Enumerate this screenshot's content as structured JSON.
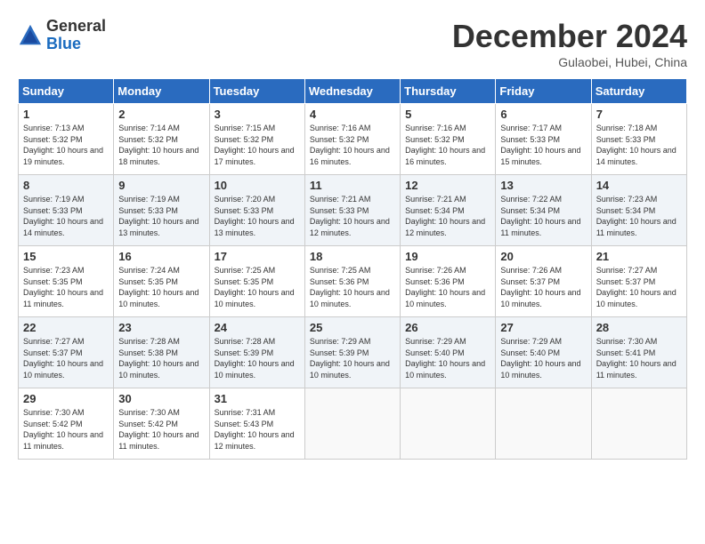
{
  "logo": {
    "general": "General",
    "blue": "Blue"
  },
  "title": "December 2024",
  "location": "Gulaobei, Hubei, China",
  "headers": [
    "Sunday",
    "Monday",
    "Tuesday",
    "Wednesday",
    "Thursday",
    "Friday",
    "Saturday"
  ],
  "weeks": [
    [
      {
        "day": "1",
        "sunrise": "7:13 AM",
        "sunset": "5:32 PM",
        "daylight": "10 hours and 19 minutes."
      },
      {
        "day": "2",
        "sunrise": "7:14 AM",
        "sunset": "5:32 PM",
        "daylight": "10 hours and 18 minutes."
      },
      {
        "day": "3",
        "sunrise": "7:15 AM",
        "sunset": "5:32 PM",
        "daylight": "10 hours and 17 minutes."
      },
      {
        "day": "4",
        "sunrise": "7:16 AM",
        "sunset": "5:32 PM",
        "daylight": "10 hours and 16 minutes."
      },
      {
        "day": "5",
        "sunrise": "7:16 AM",
        "sunset": "5:32 PM",
        "daylight": "10 hours and 16 minutes."
      },
      {
        "day": "6",
        "sunrise": "7:17 AM",
        "sunset": "5:33 PM",
        "daylight": "10 hours and 15 minutes."
      },
      {
        "day": "7",
        "sunrise": "7:18 AM",
        "sunset": "5:33 PM",
        "daylight": "10 hours and 14 minutes."
      }
    ],
    [
      {
        "day": "8",
        "sunrise": "7:19 AM",
        "sunset": "5:33 PM",
        "daylight": "10 hours and 14 minutes."
      },
      {
        "day": "9",
        "sunrise": "7:19 AM",
        "sunset": "5:33 PM",
        "daylight": "10 hours and 13 minutes."
      },
      {
        "day": "10",
        "sunrise": "7:20 AM",
        "sunset": "5:33 PM",
        "daylight": "10 hours and 13 minutes."
      },
      {
        "day": "11",
        "sunrise": "7:21 AM",
        "sunset": "5:33 PM",
        "daylight": "10 hours and 12 minutes."
      },
      {
        "day": "12",
        "sunrise": "7:21 AM",
        "sunset": "5:34 PM",
        "daylight": "10 hours and 12 minutes."
      },
      {
        "day": "13",
        "sunrise": "7:22 AM",
        "sunset": "5:34 PM",
        "daylight": "10 hours and 11 minutes."
      },
      {
        "day": "14",
        "sunrise": "7:23 AM",
        "sunset": "5:34 PM",
        "daylight": "10 hours and 11 minutes."
      }
    ],
    [
      {
        "day": "15",
        "sunrise": "7:23 AM",
        "sunset": "5:35 PM",
        "daylight": "10 hours and 11 minutes."
      },
      {
        "day": "16",
        "sunrise": "7:24 AM",
        "sunset": "5:35 PM",
        "daylight": "10 hours and 10 minutes."
      },
      {
        "day": "17",
        "sunrise": "7:25 AM",
        "sunset": "5:35 PM",
        "daylight": "10 hours and 10 minutes."
      },
      {
        "day": "18",
        "sunrise": "7:25 AM",
        "sunset": "5:36 PM",
        "daylight": "10 hours and 10 minutes."
      },
      {
        "day": "19",
        "sunrise": "7:26 AM",
        "sunset": "5:36 PM",
        "daylight": "10 hours and 10 minutes."
      },
      {
        "day": "20",
        "sunrise": "7:26 AM",
        "sunset": "5:37 PM",
        "daylight": "10 hours and 10 minutes."
      },
      {
        "day": "21",
        "sunrise": "7:27 AM",
        "sunset": "5:37 PM",
        "daylight": "10 hours and 10 minutes."
      }
    ],
    [
      {
        "day": "22",
        "sunrise": "7:27 AM",
        "sunset": "5:37 PM",
        "daylight": "10 hours and 10 minutes."
      },
      {
        "day": "23",
        "sunrise": "7:28 AM",
        "sunset": "5:38 PM",
        "daylight": "10 hours and 10 minutes."
      },
      {
        "day": "24",
        "sunrise": "7:28 AM",
        "sunset": "5:39 PM",
        "daylight": "10 hours and 10 minutes."
      },
      {
        "day": "25",
        "sunrise": "7:29 AM",
        "sunset": "5:39 PM",
        "daylight": "10 hours and 10 minutes."
      },
      {
        "day": "26",
        "sunrise": "7:29 AM",
        "sunset": "5:40 PM",
        "daylight": "10 hours and 10 minutes."
      },
      {
        "day": "27",
        "sunrise": "7:29 AM",
        "sunset": "5:40 PM",
        "daylight": "10 hours and 10 minutes."
      },
      {
        "day": "28",
        "sunrise": "7:30 AM",
        "sunset": "5:41 PM",
        "daylight": "10 hours and 11 minutes."
      }
    ],
    [
      {
        "day": "29",
        "sunrise": "7:30 AM",
        "sunset": "5:42 PM",
        "daylight": "10 hours and 11 minutes."
      },
      {
        "day": "30",
        "sunrise": "7:30 AM",
        "sunset": "5:42 PM",
        "daylight": "10 hours and 11 minutes."
      },
      {
        "day": "31",
        "sunrise": "7:31 AM",
        "sunset": "5:43 PM",
        "daylight": "10 hours and 12 minutes."
      },
      null,
      null,
      null,
      null
    ]
  ],
  "labels": {
    "sunrise": "Sunrise:",
    "sunset": "Sunset:",
    "daylight": "Daylight:"
  }
}
